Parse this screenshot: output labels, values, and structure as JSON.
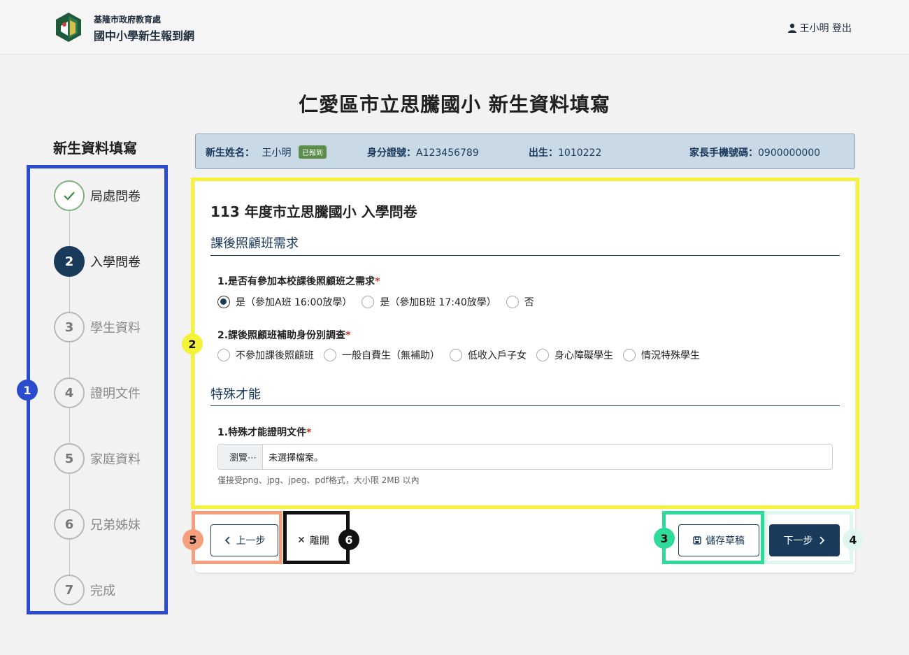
{
  "header": {
    "org": "基隆市政府教育處",
    "site_name": "國中小學新生報到網",
    "user_label": "王小明 登出"
  },
  "page_title": "仁愛區市立思騰國小 新生資料填寫",
  "sidebar": {
    "title": "新生資料填寫",
    "steps": [
      {
        "num": "✓",
        "label": "局處問卷",
        "state": "done"
      },
      {
        "num": "2",
        "label": "入學問卷",
        "state": "active"
      },
      {
        "num": "3",
        "label": "學生資料",
        "state": "pending"
      },
      {
        "num": "4",
        "label": "證明文件",
        "state": "pending"
      },
      {
        "num": "5",
        "label": "家庭資料",
        "state": "pending"
      },
      {
        "num": "6",
        "label": "兄弟姊妹",
        "state": "pending"
      },
      {
        "num": "7",
        "label": "完成",
        "state": "pending"
      }
    ]
  },
  "student_info": {
    "name_label": "新生姓名：",
    "name_value": "王小明",
    "status_tag": "已報到",
    "id_label": "身分證號：",
    "id_value": "A123456789",
    "birth_label": "出生：",
    "birth_value": "1010222",
    "phone_label": "家長手機號碼：",
    "phone_value": "0900000000"
  },
  "form": {
    "title": "113 年度市立思騰國小 入學問卷",
    "section1": {
      "heading": "課後照顧班需求",
      "q1": {
        "label": "1.是否有參加本校課後照顧班之需求",
        "required": "*",
        "options": [
          "是（參加A班 16:00放學）",
          "是（參加B班 17:40放學）",
          "否"
        ],
        "selected_index": 0
      },
      "q2": {
        "label": "2.課後照顧班補助身份別調查",
        "required": "*",
        "options": [
          "不參加課後照顧班",
          "一般自費生（無補助）",
          "低收入戶子女",
          "身心障礙學生",
          "情況特殊學生"
        ]
      }
    },
    "section2": {
      "heading": "特殊才能",
      "q1": {
        "label": "1.特殊才能證明文件",
        "required": "*",
        "browse_label": "瀏覽⋯",
        "file_status": "未選擇檔案。",
        "hint": "僅接受png、jpg、jpeg、pdf格式，大小限 2MB 以內"
      }
    }
  },
  "actions": {
    "prev_label": "上一步",
    "leave_label": "離開",
    "save_label": "儲存草稿",
    "next_label": "下一步"
  },
  "annotations": {
    "badges": [
      "1",
      "2",
      "3",
      "4",
      "5",
      "6"
    ],
    "colors": {
      "1": "#2b4ccf",
      "2": "#f5f23a",
      "3": "#2edb9a",
      "4": "#e0f7ef",
      "5": "#f4a07f",
      "6": "#111111"
    }
  },
  "colors": {
    "primary": "#1a3a5c",
    "info_bar": "#c9d9e6",
    "tag_green": "#5c8d4b",
    "required_red": "#c0392b"
  }
}
